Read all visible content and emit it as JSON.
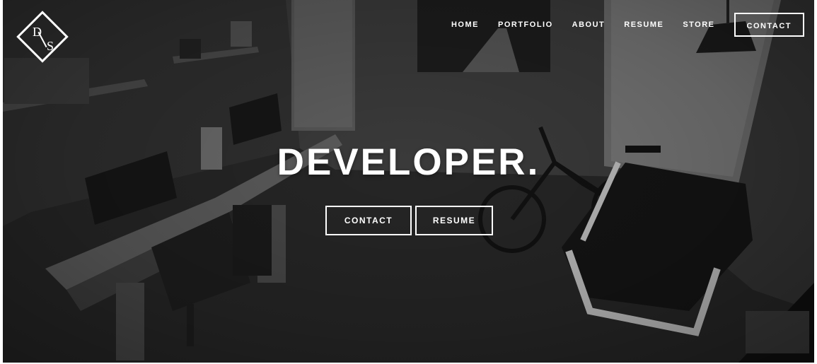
{
  "brand": {
    "logo_letters": {
      "top": "D",
      "bottom": "S"
    }
  },
  "nav": {
    "items": [
      {
        "label": "HOME"
      },
      {
        "label": "PORTFOLIO"
      },
      {
        "label": "ABOUT"
      },
      {
        "label": "RESUME"
      },
      {
        "label": "STORE"
      }
    ],
    "contact_label": "CONTACT"
  },
  "hero": {
    "headline": "DEVELOPER.",
    "buttons": {
      "contact": "CONTACT",
      "resume": "RESUME"
    }
  },
  "colors": {
    "text": "#ffffff",
    "background": "#242424"
  }
}
